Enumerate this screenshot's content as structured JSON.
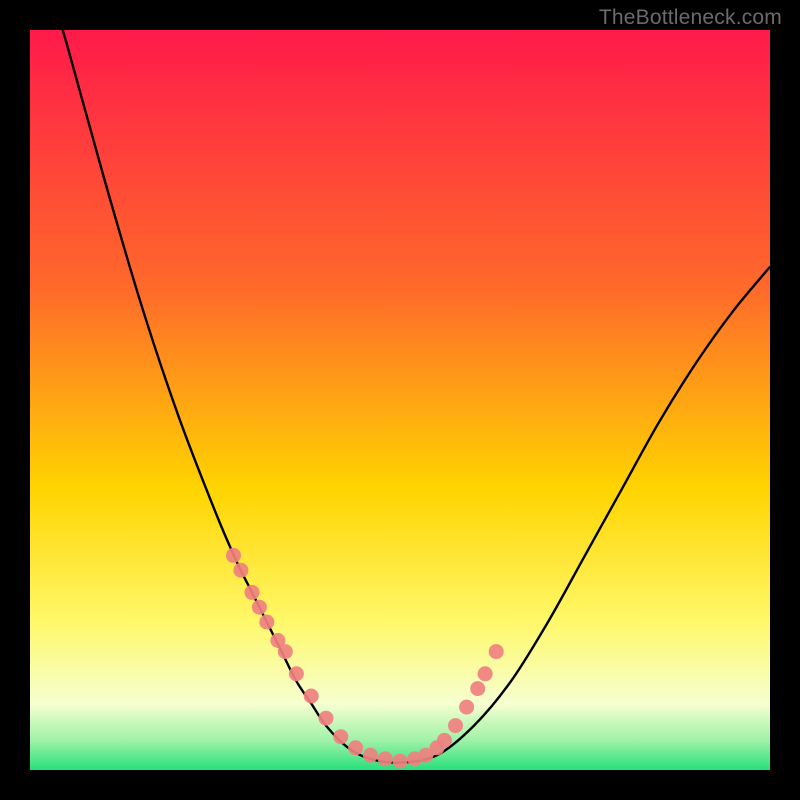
{
  "watermark": "TheBottleneck.com",
  "colors": {
    "top": "#ff1a4a",
    "upper_mid": "#ff6a2a",
    "mid": "#ffd400",
    "lower_mid": "#fff86a",
    "pale": "#f6ffd0",
    "green": "#28e07a",
    "curve": "#000000",
    "dot": "#f08080"
  },
  "chart_data": {
    "type": "line",
    "title": "",
    "xlabel": "",
    "ylabel": "",
    "xlim": [
      0,
      100
    ],
    "ylim": [
      0,
      100
    ],
    "grid": false,
    "note": "Axes are unlabeled in the source image. x is normalized horizontal position (0 left, 100 right) and y is normalized height (0 bottom, 100 top). Values are visually estimated.",
    "series": [
      {
        "name": "bottleneck-curve",
        "x": [
          0,
          5,
          10,
          15,
          20,
          25,
          28,
          30,
          32,
          34,
          36,
          38,
          40,
          43,
          46,
          50,
          55,
          60,
          65,
          70,
          75,
          80,
          85,
          90,
          95,
          100
        ],
        "values": [
          115,
          98,
          80,
          63,
          48,
          35,
          28,
          24,
          20,
          16,
          12,
          9,
          6,
          3,
          1.5,
          1,
          2,
          6,
          12,
          20,
          29,
          38,
          47,
          55,
          62,
          68
        ]
      }
    ],
    "points": {
      "name": "highlight-dots",
      "x": [
        27.5,
        28.5,
        30,
        31,
        32,
        33.5,
        34.5,
        36,
        38,
        40,
        42,
        44,
        46,
        48,
        50,
        52,
        53.5,
        55,
        56,
        57.5,
        59,
        60.5,
        61.5,
        63
      ],
      "y": [
        29,
        27,
        24,
        22,
        20,
        17.5,
        16,
        13,
        10,
        7,
        4.5,
        3,
        2,
        1.5,
        1.2,
        1.5,
        2,
        3,
        4,
        6,
        8.5,
        11,
        13,
        16
      ]
    },
    "background_gradient_stops": [
      {
        "pct": 0,
        "color": "#ff1a4a"
      },
      {
        "pct": 35,
        "color": "#ff6a2a"
      },
      {
        "pct": 62,
        "color": "#ffd400"
      },
      {
        "pct": 80,
        "color": "#fff86a"
      },
      {
        "pct": 91,
        "color": "#f6ffd0"
      },
      {
        "pct": 96,
        "color": "#9ff2a8"
      },
      {
        "pct": 100,
        "color": "#28e07a"
      }
    ]
  }
}
